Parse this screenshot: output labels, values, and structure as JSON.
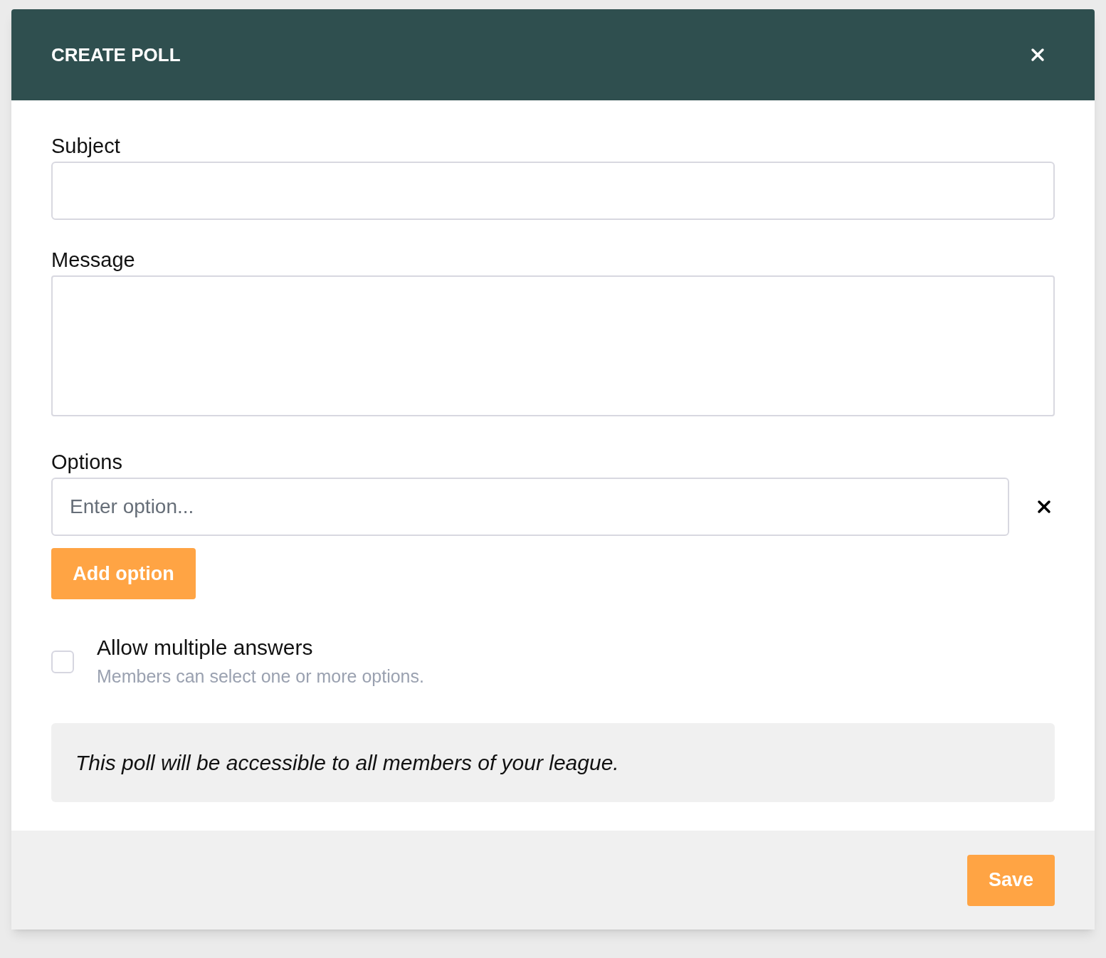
{
  "dialog": {
    "title": "CREATE POLL"
  },
  "subject": {
    "label": "Subject"
  },
  "message": {
    "label": "Message"
  },
  "options": {
    "label": "Options",
    "items": [
      {
        "placeholder": "Enter option..."
      }
    ],
    "add_button": "Add option"
  },
  "allow_multiple": {
    "label": "Allow multiple answers",
    "hint": "Members can select one or more options.",
    "checked": false
  },
  "notice": "This poll will be accessible to all members of your league.",
  "footer": {
    "save_button": "Save"
  }
}
